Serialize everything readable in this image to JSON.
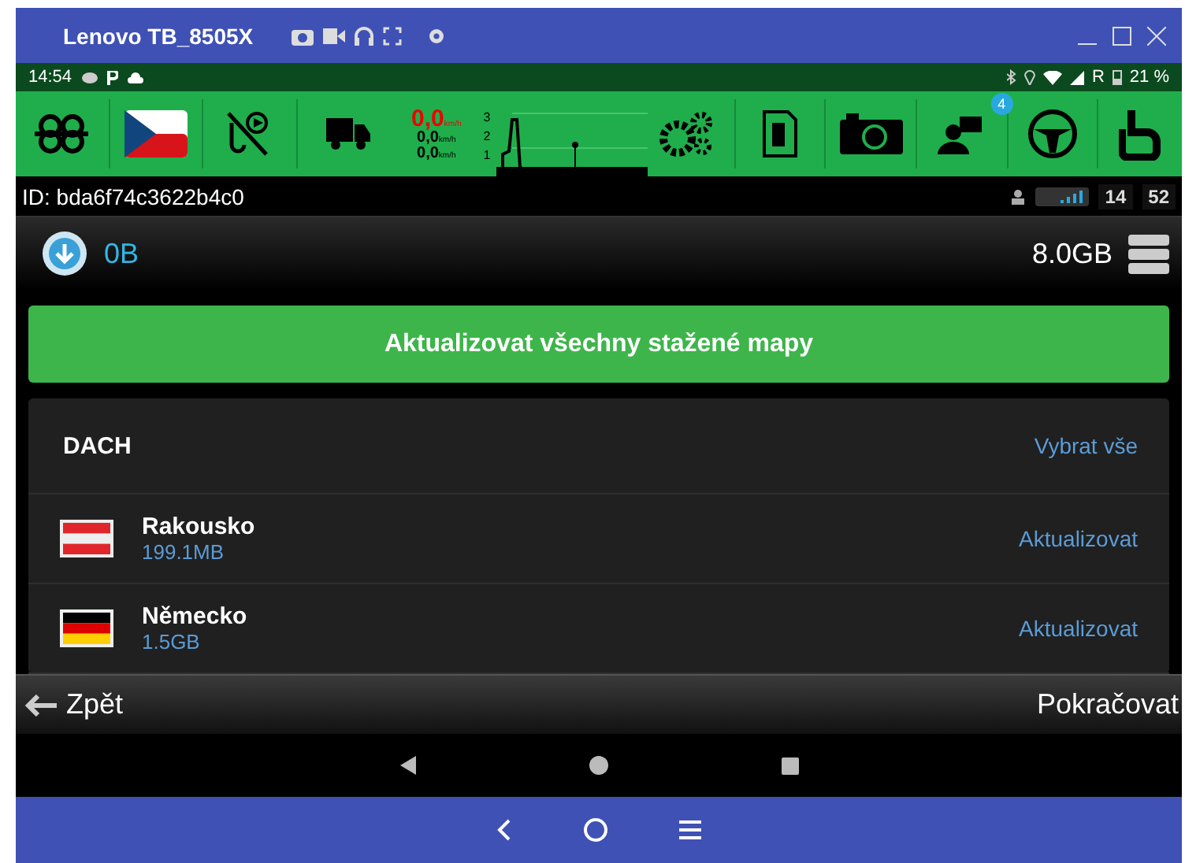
{
  "window": {
    "title": "Lenovo TB_8505X"
  },
  "status_bar": {
    "time": "14:54",
    "network": "R",
    "battery": "21 %"
  },
  "toolbar": {
    "speeds": [
      {
        "value": "0,0",
        "unit": "km/h",
        "alert": true
      },
      {
        "value": "0,0",
        "unit": "km/h",
        "alert": false
      },
      {
        "value": "0,0",
        "unit": "km/h",
        "alert": false
      }
    ],
    "gauge_ticks": [
      "3",
      "2",
      "1"
    ],
    "messages_badge": "4"
  },
  "id_bar": {
    "id": "ID: bda6f74c3622b4c0",
    "hours": "14",
    "minutes": "52"
  },
  "storage": {
    "downloaded": "0B",
    "free": "8.0GB"
  },
  "update_all_button": "Aktualizovat všechny stažené mapy",
  "region": {
    "title": "DACH",
    "select_all": "Vybrat vše",
    "countries": [
      {
        "name": "Rakousko",
        "size": "199.1MB",
        "action": "Aktualizovat",
        "kind": "austria"
      },
      {
        "name": "Německo",
        "size": "1.5GB",
        "action": "Aktualizovat",
        "kind": "germany"
      }
    ]
  },
  "footer": {
    "back": "Zpět",
    "next": "Pokračovat"
  }
}
